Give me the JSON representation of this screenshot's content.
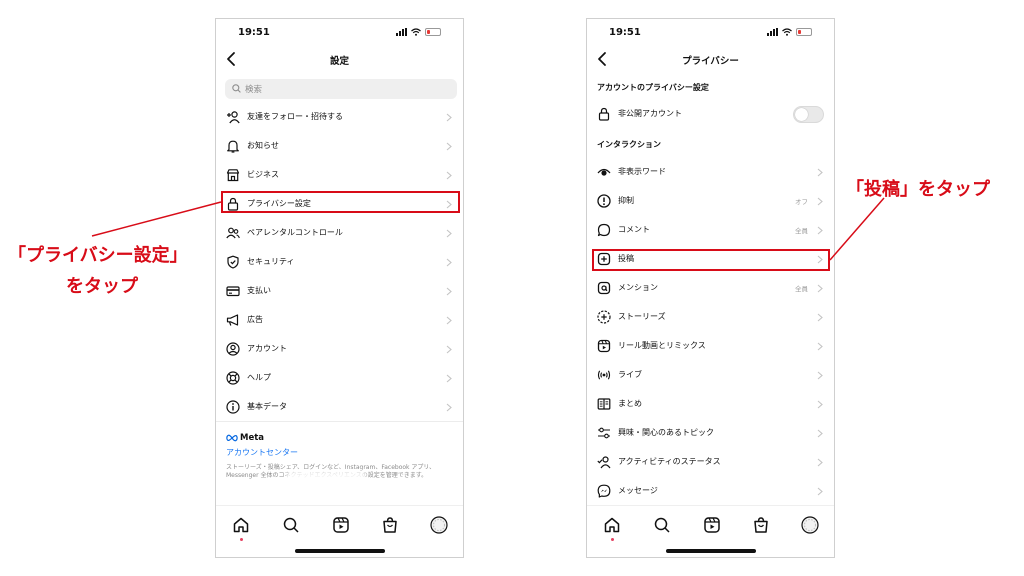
{
  "left_screen": {
    "time": "19:51",
    "title": "設定",
    "search_placeholder": "検索",
    "items": [
      {
        "label": "友達をフォロー・招待する",
        "icon": "add-person-icon"
      },
      {
        "label": "お知らせ",
        "icon": "bell-icon"
      },
      {
        "label": "ビジネス",
        "icon": "store-icon"
      },
      {
        "label": "プライバシー設定",
        "icon": "lock-icon"
      },
      {
        "label": "ペアレンタルコントロール",
        "icon": "people-icon"
      },
      {
        "label": "セキュリティ",
        "icon": "shield-icon"
      },
      {
        "label": "支払い",
        "icon": "card-icon"
      },
      {
        "label": "広告",
        "icon": "megaphone-icon"
      },
      {
        "label": "アカウント",
        "icon": "person-circle-icon"
      },
      {
        "label": "ヘルプ",
        "icon": "lifebuoy-icon"
      },
      {
        "label": "基本データ",
        "icon": "info-icon"
      }
    ],
    "meta_logo": "Meta",
    "meta_link": "アカウントセンター",
    "meta_description": "ストーリーズ・投稿シェア、ログインなど、Instagram、Facebook アプリ、Messenger 全体のコネクテッドエクスペリエンスの設定を管理できます。"
  },
  "right_screen": {
    "time": "19:51",
    "title": "プライバシー",
    "section_account": "アカウントのプライバシー設定",
    "private_account_label": "非公開アカウント",
    "private_account_enabled": false,
    "section_interaction": "インタラクション",
    "items": [
      {
        "label": "非表示ワード",
        "value": "",
        "icon": "eye-hidden-icon"
      },
      {
        "label": "抑制",
        "value": "オフ",
        "icon": "alert-circle-icon"
      },
      {
        "label": "コメント",
        "value": "全員",
        "icon": "comment-icon"
      },
      {
        "label": "投稿",
        "value": "",
        "icon": "plus-square-icon"
      },
      {
        "label": "メンション",
        "value": "全員",
        "icon": "at-icon"
      },
      {
        "label": "ストーリーズ",
        "value": "",
        "icon": "story-plus-icon"
      },
      {
        "label": "リール動画とリミックス",
        "value": "",
        "icon": "reels-icon"
      },
      {
        "label": "ライブ",
        "value": "",
        "icon": "live-icon"
      },
      {
        "label": "まとめ",
        "value": "",
        "icon": "guide-icon"
      },
      {
        "label": "興味・関心のあるトピック",
        "value": "",
        "icon": "sliders-icon"
      },
      {
        "label": "アクティビティのステータス",
        "value": "",
        "icon": "activity-icon"
      },
      {
        "label": "メッセージ",
        "value": "",
        "icon": "messenger-icon"
      }
    ]
  },
  "annotations": {
    "left_line1": "「プライバシー設定」",
    "left_line2": "をタップ",
    "right": "「投稿」をタップ"
  },
  "colors": {
    "highlight": "#d80c18",
    "link": "#1a77f2",
    "notification_dot": "#e4405f"
  }
}
